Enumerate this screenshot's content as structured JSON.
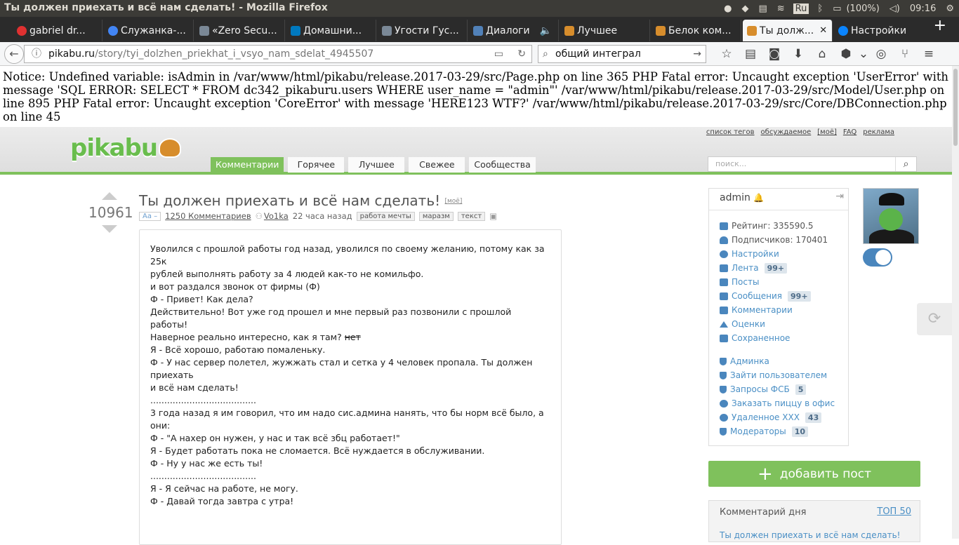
{
  "os": {
    "window_title": "Ты должен приехать и всё нам сделать! - Mozilla Firefox",
    "lang": "Ru",
    "battery": "(100%)",
    "time": "09:16"
  },
  "tabs": [
    {
      "label": "gabriel dr...",
      "color": "#e03131"
    },
    {
      "label": "Служанка-...",
      "color": "#4285f4"
    },
    {
      "label": "«Zero Secu...",
      "color": "#7a8896"
    },
    {
      "label": "Домашни...",
      "color": "#0079bf"
    },
    {
      "label": "Угости Гус...",
      "color": "#7a8896"
    },
    {
      "label": "Диалоги",
      "color": "#5181b8"
    },
    {
      "label": "Лучшее",
      "color": "#d78d2c"
    },
    {
      "label": "Белок ком...",
      "color": "#d78d2c"
    },
    {
      "label": "Ты долж...",
      "color": "#d78d2c"
    },
    {
      "label": "Настройки",
      "color": "#0a84ff"
    }
  ],
  "navbar": {
    "url_host": "pikabu.ru",
    "url_path": "/story/tyi_dolzhen_priekhat_i_vsyo_nam_sdelat_4945507",
    "search_value": "общий интеграл"
  },
  "notice": "Notice: Undefined variable: isAdmin in /var/www/html/pikabu/release.2017-03-29/src/Page.php on line 365 PHP Fatal error: Uncaught exception 'UserError' with message 'SQL ERROR: SELECT * FROM dc342_pikaburu.users WHERE user_name = \"admin\"' /var/www/html/pikabu/release.2017-03-29/src/Model/User.php on line 895 PHP Fatal error: Uncaught exception 'CoreError' with message 'HERE123 WTF?' /var/www/html/pikabu/release.2017-03-29/src/Core/DBConnection.php on line 45",
  "site": {
    "logo": "pikabu",
    "top_links": [
      "список тегов",
      "обсуждаемое",
      "[моё]",
      "FAQ",
      "реклама"
    ],
    "tabs": [
      "Комментарии",
      "Горячее",
      "Лучшее",
      "Свежее",
      "Сообщества"
    ],
    "search_placeholder": "поиск..."
  },
  "story": {
    "score": "10961",
    "title": "Ты должен приехать и всё нам сделать!",
    "moe": "[моё]",
    "aa": "Аа –",
    "comments": "1250 Комментариев",
    "author": "Vo1ka",
    "time": "22 часа назад",
    "tags": [
      "работа мечты",
      "маразм",
      "текст"
    ],
    "body": [
      "Уволился с прошлой работы год назад, уволился по своему желанию, потому как за 25к",
      "рублей выполнять работу за 4 людей как-то не комильфо.",
      "и вот раздался звонок от фирмы (Ф)",
      "",
      "Ф - Привет! Как дела?",
      "",
      "Действительно! Вот уже год прошел и мне первый раз позвонили с прошлой работы!",
      "Наверное реально интересно, как я там?",
      "",
      "Я - Всё хорошо, работаю помаленьку.",
      "Ф - У нас сервер полетел, жужжать стал и сетка у 4 человек пропала. Ты должен приехать",
      "и всё нам сделать!",
      "",
      "",
      "......................................",
      "3 года назад я им говорил, что им надо сис.админа нанять, что бы норм всё было, а они:",
      "Ф - \"А нахер он нужен, у нас и так всё збц работает!\"",
      "Я - Будет работать пока не сломается. Всё нуждается в обслуживании.",
      "Ф - Ну у нас же есть ты!",
      "......................................",
      "",
      "Я - Я сейчас на работе, не могу.",
      "Ф - Давай тогда завтра с утра!"
    ],
    "strike": "нет"
  },
  "user": {
    "name": "admin",
    "rating": "Рейтинг: 335590.5",
    "subs": "Подписчиков: 170401",
    "menu": [
      {
        "label": "Настройки",
        "badge": ""
      },
      {
        "label": "Лента",
        "badge": "99+"
      },
      {
        "label": "Посты",
        "badge": ""
      },
      {
        "label": "Сообщения",
        "badge": "99+"
      },
      {
        "label": "Комментарии",
        "badge": ""
      },
      {
        "label": "Оценки",
        "badge": ""
      },
      {
        "label": "Сохраненное",
        "badge": ""
      }
    ],
    "admin_menu": [
      {
        "label": "Админка",
        "badge": ""
      },
      {
        "label": "Зайти пользователем",
        "badge": ""
      },
      {
        "label": "Запросы ФСБ",
        "badge": "5"
      },
      {
        "label": "Заказать пиццу в офис",
        "badge": ""
      },
      {
        "label": "Удаленное ХХХ",
        "badge": "43"
      },
      {
        "label": "Модераторы",
        "badge": "10"
      }
    ]
  },
  "sidebar": {
    "add_post": "добавить пост",
    "comment_day": "Комментарий дня",
    "top50": "ТОП 50",
    "comment_day_story": "Ты должен приехать и всё нам сделать!"
  }
}
